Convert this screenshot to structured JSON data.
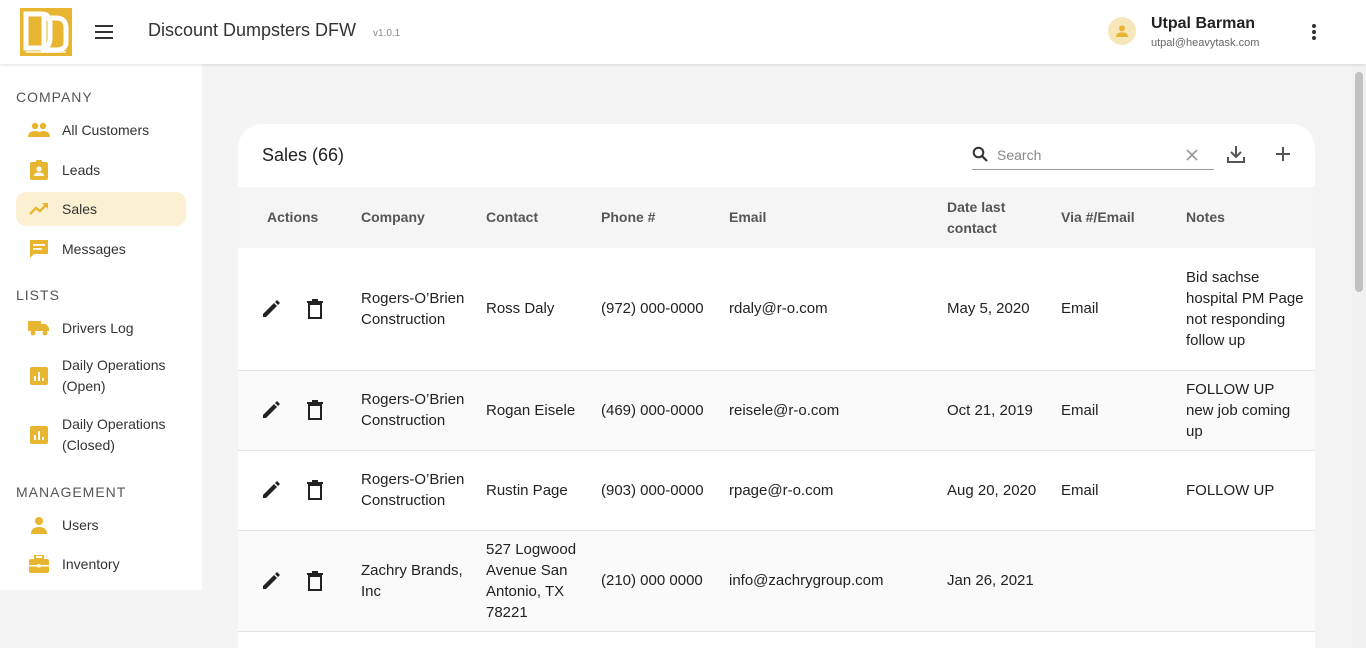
{
  "header": {
    "app_title": "Discount Dumpsters DFW",
    "version": "v1.0.1",
    "user_name": "Utpal Barman",
    "user_email": "utpal@heavytask.com"
  },
  "sidebar": {
    "company_title": "COMPANY",
    "company_items": [
      {
        "label": "All Customers",
        "icon": "people-icon"
      },
      {
        "label": "Leads",
        "icon": "badge-icon"
      },
      {
        "label": "Sales",
        "icon": "trending-up-icon",
        "active": true
      },
      {
        "label": "Messages",
        "icon": "chat-icon"
      }
    ],
    "lists_title": "LISTS",
    "lists_items": [
      {
        "label": "Drivers Log",
        "icon": "truck-icon"
      },
      {
        "label": "Daily Operations (Open)",
        "icon": "bar-chart-icon"
      },
      {
        "label": "Daily Operations (Closed)",
        "icon": "bar-chart-icon"
      }
    ],
    "management_title": "MANAGEMENT",
    "management_items": [
      {
        "label": "Users",
        "icon": "person-icon"
      },
      {
        "label": "Inventory",
        "icon": "briefcase-icon"
      }
    ]
  },
  "sales": {
    "title": "Sales (66)",
    "search_placeholder": "Search",
    "columns": {
      "actions": "Actions",
      "company": "Company",
      "contact": "Contact",
      "phone": "Phone #",
      "email": "Email",
      "date": "Date last contact",
      "via": "Via #/Email",
      "notes": "Notes"
    },
    "rows": [
      {
        "company": "Rogers-O’Brien Construction",
        "contact": "Ross Daly",
        "phone": "(972) 000-0000",
        "email": "rdaly@r-o.com",
        "date": "May 5, 2020",
        "via": "Email",
        "notes": "Bid sachse hospital PM Page not responding follow up"
      },
      {
        "company": "Rogers-O’Brien Construction",
        "contact": "Rogan Eisele",
        "phone": "(469) 000-0000",
        "email": "reisele@r-o.com",
        "date": "Oct 21, 2019",
        "via": "Email",
        "notes": "FOLLOW UP new job coming up"
      },
      {
        "company": "Rogers-O’Brien Construction",
        "contact": "Rustin Page",
        "phone": "(903) 000-0000",
        "email": "rpage@r-o.com",
        "date": "Aug 20, 2020",
        "via": "Email",
        "notes": "FOLLOW UP"
      },
      {
        "company": "Zachry Brands, Inc",
        "contact": "527 Logwood Avenue San Antonio, TX 78221",
        "phone": "(210) 000 0000",
        "email": "info@zachrygroup.com",
        "date": "Jan 26, 2021",
        "via": "",
        "notes": ""
      }
    ]
  },
  "colors": {
    "accent": "#e8b531",
    "active_bg": "#fbf1d2"
  }
}
